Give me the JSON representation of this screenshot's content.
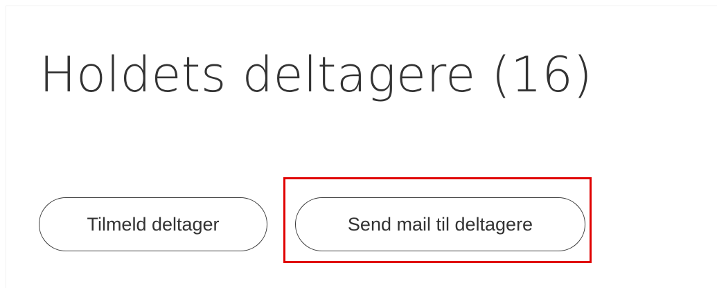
{
  "page": {
    "title": "Holdets deltagere (16)"
  },
  "actions": {
    "enroll_label": "Tilmeld deltager",
    "mail_label": "Send mail til deltagere"
  },
  "colors": {
    "text": "#333333",
    "button_border": "#3a3a3a",
    "highlight": "#e00000"
  }
}
